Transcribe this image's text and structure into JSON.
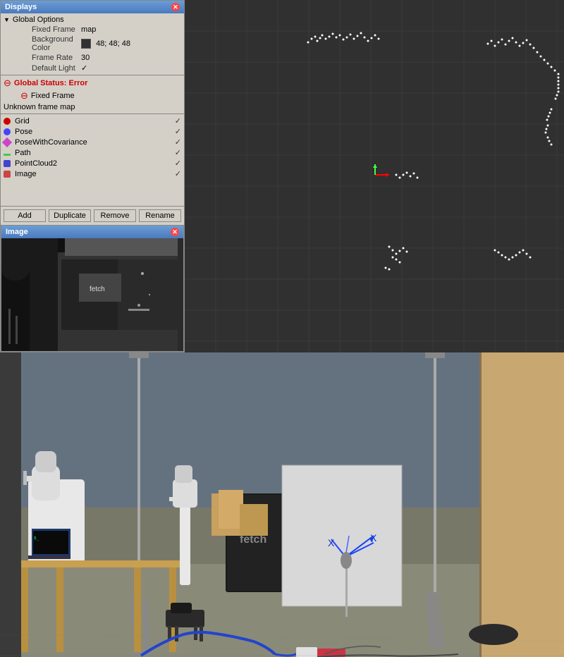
{
  "displays_panel": {
    "title": "Displays",
    "global_options": {
      "label": "Global Options",
      "fixed_frame": {
        "name": "Fixed Frame",
        "value": "map"
      },
      "background_color": {
        "name": "Background Color",
        "value": "48; 48; 48",
        "swatch": "#303030"
      },
      "frame_rate": {
        "name": "Frame Rate",
        "value": "30"
      },
      "default_light": {
        "name": "Default Light",
        "value": "✓"
      }
    },
    "global_status": {
      "label": "Global Status: Error",
      "fixed_frame": {
        "label": "Fixed Frame",
        "value": "Unknown frame map"
      }
    },
    "items": [
      {
        "id": "grid",
        "label": "Grid",
        "color": "#cc0000",
        "checked": "✓"
      },
      {
        "id": "pose",
        "label": "Pose",
        "color": "#4444ff",
        "checked": "✓"
      },
      {
        "id": "pose_with_covariance",
        "label": "PoseWithCovariance",
        "color": "#cc44cc",
        "checked": "✓"
      },
      {
        "id": "path",
        "label": "Path",
        "color": "#44cc44",
        "checked": "✓"
      },
      {
        "id": "point_cloud2",
        "label": "PointCloud2",
        "color": "#4444cc",
        "checked": "✓"
      },
      {
        "id": "image",
        "label": "Image",
        "color": "#cc4444",
        "checked": "✓"
      }
    ],
    "footer_buttons": [
      "Add",
      "Duplicate",
      "Remove",
      "Rename"
    ]
  },
  "image_panel": {
    "title": "Image"
  },
  "map_view": {
    "background": "#303030"
  },
  "icons": {
    "close": "✕",
    "checkmark": "✓",
    "expand": "▶",
    "collapse": "▼"
  }
}
